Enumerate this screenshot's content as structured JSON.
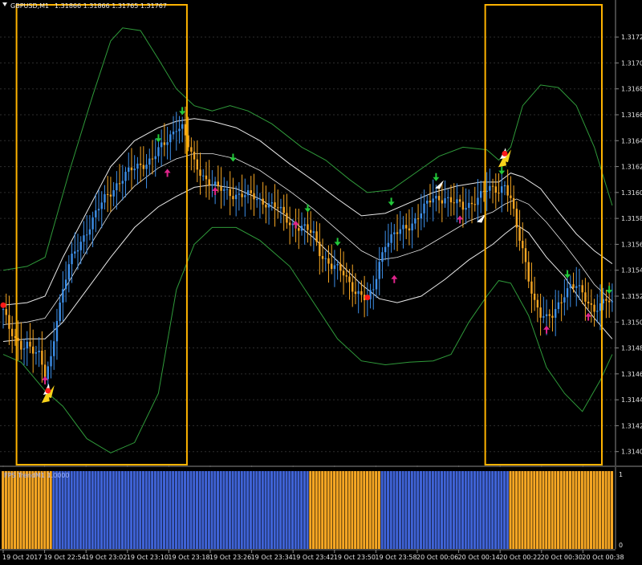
{
  "header": {
    "title": "GBPUSD,M1",
    "ohlc": "1.31866 1.31866 1.31765 1.31767"
  },
  "indicator": {
    "label": "FPS TrendM1 1.0000",
    "scale_max": "1",
    "scale_min": "0"
  },
  "colors": {
    "background": "#000000",
    "bull": "#3d8fe8",
    "bear": "#f5a623",
    "band_outer": "#2f9a3a",
    "band_inner": "#e8e8e8",
    "highlight_box": "#ffb300",
    "hist_blue": "#3f63d6",
    "hist_orange": "#f5a623",
    "arrow_green": "#22c93a",
    "arrow_magenta": "#e0248c",
    "dot_red": "#ff1a1a"
  },
  "chart_data": [
    {
      "type": "candlestick",
      "symbol": "GBPUSD",
      "timeframe": "M1",
      "y_ticks": [
        "1.31725",
        "1.31705",
        "1.31685",
        "1.31665",
        "1.31645",
        "1.31625",
        "1.31605",
        "1.31585",
        "1.31565",
        "1.31545",
        "1.31525",
        "1.31505",
        "1.31485",
        "1.31465",
        "1.31445",
        "1.31425",
        "1.31405"
      ],
      "ylim": [
        1.31398,
        1.31735
      ],
      "x_ticks": [
        "19 Oct 2017",
        "19 Oct 22:54",
        "19 Oct 23:02",
        "19 Oct 23:10",
        "19 Oct 23:18",
        "19 Oct 23:26",
        "19 Oct 23:34",
        "19 Oct 23:42",
        "19 Oct 23:50",
        "19 Oct 23:58",
        "20 Oct 00:06",
        "20 Oct 00:14",
        "20 Oct 00:22",
        "20 Oct 00:30",
        "20 Oct 00:38"
      ],
      "close_path": [
        [
          0,
          1.31515
        ],
        [
          2,
          1.31498
        ],
        [
          4,
          1.3149
        ],
        [
          6,
          1.31487
        ],
        [
          8,
          1.3149
        ],
        [
          10,
          1.31483
        ],
        [
          12,
          1.31478
        ],
        [
          14,
          1.31462
        ],
        [
          16,
          1.31478
        ],
        [
          18,
          1.3151
        ],
        [
          22,
          1.31548
        ],
        [
          26,
          1.31568
        ],
        [
          30,
          1.31584
        ],
        [
          34,
          1.316
        ],
        [
          38,
          1.31612
        ],
        [
          42,
          1.3162
        ],
        [
          46,
          1.31627
        ],
        [
          50,
          1.31631
        ],
        [
          54,
          1.31642
        ],
        [
          58,
          1.31657
        ],
        [
          60,
          1.31655
        ],
        [
          62,
          1.3164
        ],
        [
          64,
          1.31627
        ],
        [
          68,
          1.31616
        ],
        [
          72,
          1.31607
        ],
        [
          76,
          1.31605
        ],
        [
          80,
          1.31603
        ],
        [
          84,
          1.31601
        ],
        [
          88,
          1.31598
        ],
        [
          92,
          1.31592
        ],
        [
          96,
          1.31582
        ],
        [
          100,
          1.31578
        ],
        [
          104,
          1.31572
        ],
        [
          106,
          1.3156
        ],
        [
          110,
          1.31548
        ],
        [
          114,
          1.31542
        ],
        [
          118,
          1.3153
        ],
        [
          122,
          1.3152
        ],
        [
          124,
          1.3153
        ],
        [
          126,
          1.31552
        ],
        [
          128,
          1.31567
        ],
        [
          132,
          1.31573
        ],
        [
          136,
          1.3158
        ],
        [
          140,
          1.3159
        ],
        [
          144,
          1.316
        ],
        [
          148,
          1.31602
        ],
        [
          150,
          1.31598
        ],
        [
          154,
          1.31593
        ],
        [
          158,
          1.316
        ],
        [
          162,
          1.31606
        ],
        [
          166,
          1.31608
        ],
        [
          168,
          1.31612
        ],
        [
          170,
          1.316
        ],
        [
          172,
          1.31576
        ],
        [
          174,
          1.3156
        ],
        [
          176,
          1.3154
        ],
        [
          178,
          1.31522
        ],
        [
          180,
          1.3151
        ],
        [
          182,
          1.31506
        ],
        [
          184,
          1.3151
        ],
        [
          186,
          1.3152
        ],
        [
          188,
          1.31528
        ],
        [
          190,
          1.31532
        ],
        [
          192,
          1.31531
        ],
        [
          194,
          1.31527
        ],
        [
          196,
          1.31521
        ],
        [
          198,
          1.31516
        ],
        [
          200,
          1.31517
        ],
        [
          202,
          1.31521
        ],
        [
          204,
          1.31518
        ]
      ],
      "bands": {
        "outer_upper": [
          [
            0,
            1.31545
          ],
          [
            8,
            1.31548
          ],
          [
            14,
            1.31555
          ],
          [
            22,
            1.3162
          ],
          [
            30,
            1.3168
          ],
          [
            36,
            1.31722
          ],
          [
            40,
            1.31732
          ],
          [
            46,
            1.3173
          ],
          [
            52,
            1.31708
          ],
          [
            58,
            1.31685
          ],
          [
            64,
            1.31672
          ],
          [
            70,
            1.31668
          ],
          [
            76,
            1.31672
          ],
          [
            82,
            1.31668
          ],
          [
            90,
            1.31658
          ],
          [
            100,
            1.3164
          ],
          [
            108,
            1.3163
          ],
          [
            116,
            1.31615
          ],
          [
            122,
            1.31605
          ],
          [
            130,
            1.31607
          ],
          [
            138,
            1.3162
          ],
          [
            146,
            1.31633
          ],
          [
            154,
            1.3164
          ],
          [
            162,
            1.31638
          ],
          [
            166,
            1.3163
          ],
          [
            170,
            1.3164
          ],
          [
            174,
            1.31672
          ],
          [
            180,
            1.31688
          ],
          [
            186,
            1.31686
          ],
          [
            192,
            1.31672
          ],
          [
            198,
            1.3164
          ],
          [
            204,
            1.31595
          ]
        ],
        "inner_upper": [
          [
            0,
            1.31518
          ],
          [
            8,
            1.3152
          ],
          [
            14,
            1.31525
          ],
          [
            20,
            1.31555
          ],
          [
            28,
            1.3159
          ],
          [
            36,
            1.31625
          ],
          [
            44,
            1.31645
          ],
          [
            52,
            1.31655
          ],
          [
            58,
            1.3166
          ],
          [
            64,
            1.31662
          ],
          [
            70,
            1.3166
          ],
          [
            78,
            1.31655
          ],
          [
            86,
            1.31645
          ],
          [
            96,
            1.31627
          ],
          [
            104,
            1.31614
          ],
          [
            112,
            1.316
          ],
          [
            120,
            1.31587
          ],
          [
            128,
            1.31589
          ],
          [
            136,
            1.31597
          ],
          [
            144,
            1.31605
          ],
          [
            152,
            1.3161
          ],
          [
            160,
            1.31613
          ],
          [
            166,
            1.31613
          ],
          [
            170,
            1.3162
          ],
          [
            174,
            1.31617
          ],
          [
            180,
            1.31608
          ],
          [
            186,
            1.3159
          ],
          [
            192,
            1.31573
          ],
          [
            198,
            1.3156
          ],
          [
            204,
            1.3155
          ]
        ],
        "inner_lower": [
          [
            0,
            1.3149
          ],
          [
            8,
            1.31492
          ],
          [
            14,
            1.31492
          ],
          [
            20,
            1.31505
          ],
          [
            28,
            1.3153
          ],
          [
            36,
            1.31555
          ],
          [
            44,
            1.31578
          ],
          [
            52,
            1.31594
          ],
          [
            58,
            1.31602
          ],
          [
            64,
            1.31609
          ],
          [
            70,
            1.31611
          ],
          [
            78,
            1.31608
          ],
          [
            86,
            1.316
          ],
          [
            96,
            1.31585
          ],
          [
            104,
            1.3157
          ],
          [
            112,
            1.31552
          ],
          [
            120,
            1.31534
          ],
          [
            126,
            1.31523
          ],
          [
            132,
            1.3152
          ],
          [
            140,
            1.31525
          ],
          [
            148,
            1.31538
          ],
          [
            156,
            1.31553
          ],
          [
            164,
            1.31565
          ],
          [
            168,
            1.31573
          ],
          [
            172,
            1.3158
          ],
          [
            176,
            1.31574
          ],
          [
            182,
            1.31555
          ],
          [
            188,
            1.3154
          ],
          [
            194,
            1.3152
          ],
          [
            198,
            1.31508
          ],
          [
            204,
            1.31492
          ]
        ],
        "outer_lower": [
          [
            0,
            1.3148
          ],
          [
            6,
            1.31474
          ],
          [
            14,
            1.31452
          ],
          [
            20,
            1.3144
          ],
          [
            28,
            1.31415
          ],
          [
            36,
            1.31404
          ],
          [
            44,
            1.31412
          ],
          [
            52,
            1.3145
          ],
          [
            58,
            1.3153
          ],
          [
            64,
            1.31565
          ],
          [
            70,
            1.31578
          ],
          [
            78,
            1.31578
          ],
          [
            86,
            1.31568
          ],
          [
            96,
            1.31548
          ],
          [
            104,
            1.3152
          ],
          [
            112,
            1.31492
          ],
          [
            120,
            1.31475
          ],
          [
            128,
            1.31472
          ],
          [
            136,
            1.31474
          ],
          [
            144,
            1.31475
          ],
          [
            150,
            1.3148
          ],
          [
            156,
            1.31505
          ],
          [
            162,
            1.31525
          ],
          [
            166,
            1.31537
          ],
          [
            170,
            1.31535
          ],
          [
            176,
            1.3151
          ],
          [
            182,
            1.3147
          ],
          [
            188,
            1.3145
          ],
          [
            194,
            1.31436
          ],
          [
            200,
            1.3146
          ],
          [
            204,
            1.3148
          ]
        ],
        "inner_center": [
          [
            0,
            1.31503
          ],
          [
            8,
            1.31505
          ],
          [
            14,
            1.31508
          ],
          [
            20,
            1.31528
          ],
          [
            28,
            1.3156
          ],
          [
            36,
            1.3159
          ],
          [
            44,
            1.3161
          ],
          [
            52,
            1.31624
          ],
          [
            58,
            1.31631
          ],
          [
            64,
            1.31635
          ],
          [
            70,
            1.31635
          ],
          [
            78,
            1.31631
          ],
          [
            86,
            1.31622
          ],
          [
            96,
            1.31606
          ],
          [
            104,
            1.31592
          ],
          [
            112,
            1.31576
          ],
          [
            120,
            1.3156
          ],
          [
            126,
            1.31553
          ],
          [
            132,
            1.31555
          ],
          [
            140,
            1.31561
          ],
          [
            148,
            1.31572
          ],
          [
            156,
            1.31583
          ],
          [
            164,
            1.3159
          ],
          [
            168,
            1.31596
          ],
          [
            172,
            1.316
          ],
          [
            176,
            1.31596
          ],
          [
            182,
            1.31582
          ],
          [
            188,
            1.31565
          ],
          [
            194,
            1.31547
          ],
          [
            198,
            1.31534
          ],
          [
            204,
            1.31521
          ]
        ]
      },
      "signals": [
        {
          "type": "arrow_up_magenta",
          "bar": 14,
          "price": 1.31462
        },
        {
          "type": "arrow_down_green",
          "bar": 52,
          "price": 1.31645
        },
        {
          "type": "arrow_up_magenta",
          "bar": 55,
          "price": 1.31622
        },
        {
          "type": "arrow_down_green",
          "bar": 60,
          "price": 1.31666
        },
        {
          "type": "arrow_up_magenta",
          "bar": 71,
          "price": 1.31608
        },
        {
          "type": "arrow_down_green",
          "bar": 77,
          "price": 1.3163
        },
        {
          "type": "arrow_up_magenta",
          "bar": 98,
          "price": 1.31582
        },
        {
          "type": "arrow_down_green",
          "bar": 102,
          "price": 1.31591
        },
        {
          "type": "arrow_down_green",
          "bar": 112,
          "price": 1.31565
        },
        {
          "type": "arrow_up_magenta",
          "bar": 131,
          "price": 1.3154
        },
        {
          "type": "arrow_down_green",
          "bar": 130,
          "price": 1.31596
        },
        {
          "type": "arrow_down_green",
          "bar": 145,
          "price": 1.31615
        },
        {
          "type": "arrow_up_magenta",
          "bar": 153,
          "price": 1.31586
        },
        {
          "type": "arrow_down_green",
          "bar": 167,
          "price": 1.3162
        },
        {
          "type": "arrow_up_magenta",
          "bar": 182,
          "price": 1.31501
        },
        {
          "type": "arrow_down_green",
          "bar": 189,
          "price": 1.3154
        },
        {
          "type": "arrow_up_magenta",
          "bar": 196,
          "price": 1.31511
        },
        {
          "type": "arrow_down_green",
          "bar": 203,
          "price": 1.31528
        }
      ],
      "dots": [
        {
          "bar": 0,
          "price": 1.31518
        },
        {
          "bar": 15,
          "price": 1.31452
        },
        {
          "bar": 122,
          "price": 1.31524
        },
        {
          "bar": 168,
          "price": 1.31635
        }
      ],
      "special_arrows": [
        {
          "bar": 15,
          "price": 1.3145,
          "kind": "yellow_cluster"
        },
        {
          "bar": 146,
          "price": 1.31612,
          "kind": "white"
        },
        {
          "bar": 160,
          "price": 1.31586,
          "kind": "white"
        },
        {
          "bar": 168,
          "price": 1.31632,
          "kind": "yellow_cluster"
        }
      ],
      "highlight_boxes": [
        {
          "from_bar": 5,
          "to_bar": 61
        },
        {
          "from_bar": 162,
          "to_bar": 200
        }
      ]
    },
    {
      "type": "bar",
      "name": "FPS TrendM1",
      "ylim": [
        0,
        1
      ],
      "segments": [
        {
          "from_bar": 0,
          "to_bar": 16,
          "value": 1,
          "color": "orange"
        },
        {
          "from_bar": 17,
          "to_bar": 102,
          "value": 1,
          "color": "blue"
        },
        {
          "from_bar": 103,
          "to_bar": 126,
          "value": 1,
          "color": "orange"
        },
        {
          "from_bar": 127,
          "to_bar": 169,
          "value": 1,
          "color": "blue"
        },
        {
          "from_bar": 170,
          "to_bar": 204,
          "value": 1,
          "color": "orange"
        }
      ]
    }
  ]
}
